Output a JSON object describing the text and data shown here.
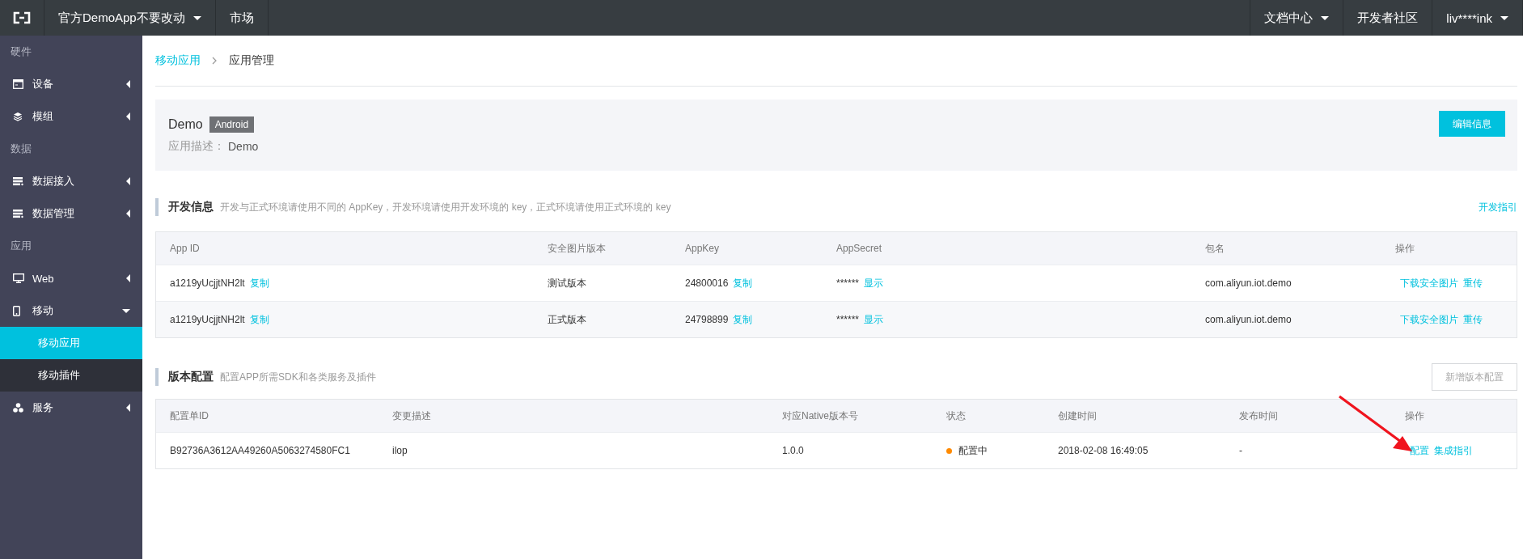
{
  "topbar": {
    "product": "官方DemoApp不要改动",
    "nav": [
      "市场"
    ],
    "right": [
      {
        "label": "文档中心",
        "dropdown": true
      },
      {
        "label": "开发者社区",
        "dropdown": false
      },
      {
        "label": "liv****ink",
        "dropdown": true
      }
    ]
  },
  "sidebar": {
    "groups": [
      {
        "heading": "硬件",
        "items": [
          {
            "label": "设备",
            "expanded": false
          },
          {
            "label": "模组",
            "expanded": false
          }
        ]
      },
      {
        "heading": "数据",
        "items": [
          {
            "label": "数据接入",
            "expanded": false
          },
          {
            "label": "数据管理",
            "expanded": false
          }
        ]
      },
      {
        "heading": "应用",
        "items": [
          {
            "label": "Web",
            "expanded": false
          },
          {
            "label": "移动",
            "expanded": true,
            "children": [
              {
                "label": "移动应用",
                "selected": true
              },
              {
                "label": "移动插件",
                "selected": false
              }
            ]
          },
          {
            "label": "服务",
            "expanded": false
          }
        ]
      }
    ]
  },
  "breadcrumb": [
    "移动应用",
    "应用管理"
  ],
  "app": {
    "name": "Demo",
    "platform": "Android",
    "description_label": "应用描述：",
    "description": "Demo",
    "edit_button": "编辑信息"
  },
  "dev_info": {
    "title": "开发信息",
    "note": "开发与正式环境请使用不同的 AppKey，开发环境请使用开发环境的 key，正式环境请使用正式环境的 key",
    "link": "开发指引",
    "table": {
      "columns": [
        "App ID",
        "安全图片版本",
        "AppKey",
        "AppSecret",
        "包名",
        "操作"
      ],
      "rows": [
        {
          "app_id": "a1219yUcjjtNH2lt",
          "app_id_action": "复制",
          "image_version": "测试版本",
          "app_key": "24800016",
          "app_key_action": "复制",
          "app_secret": "******",
          "app_secret_action": "显示",
          "package": "com.aliyun.iot.demo",
          "actions": [
            "下载安全图片",
            "重传"
          ]
        },
        {
          "app_id": "a1219yUcjjtNH2lt",
          "app_id_action": "复制",
          "image_version": "正式版本",
          "app_key": "24798899",
          "app_key_action": "复制",
          "app_secret": "******",
          "app_secret_action": "显示",
          "package": "com.aliyun.iot.demo",
          "actions": [
            "下载安全图片",
            "重传"
          ]
        }
      ]
    }
  },
  "version_config": {
    "title": "版本配置",
    "note": "配置APP所需SDK和各类服务及插件",
    "button": {
      "label": "新增版本配置",
      "disabled": true
    },
    "table": {
      "columns": [
        "配置单ID",
        "变更描述",
        "对应Native版本号",
        "状态",
        "创建时间",
        "发布时间",
        "操作"
      ],
      "rows": [
        {
          "id": "B92736A3612AA49260A5063274580FC1",
          "description": "ilop",
          "native_version": "1.0.0",
          "status": {
            "label": "配置中",
            "color": "#ff8a00"
          },
          "created": "2018-02-08 16:49:05",
          "published": "-",
          "actions": [
            "配置",
            "集成指引"
          ]
        }
      ]
    }
  }
}
